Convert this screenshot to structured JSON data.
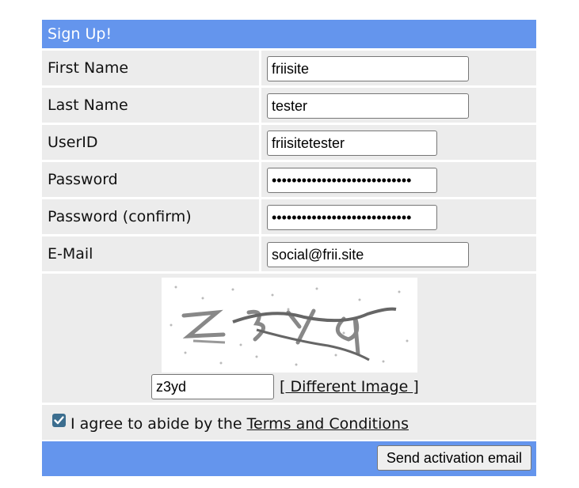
{
  "form": {
    "title": "Sign Up!",
    "fields": [
      {
        "label": "First Name",
        "value": "friisite"
      },
      {
        "label": "Last Name",
        "value": "tester"
      },
      {
        "label": "UserID",
        "value": "friisitetester"
      },
      {
        "label": "Password",
        "value": "••••••••••••••••••••••••••••"
      },
      {
        "label": "Password (confirm)",
        "value": "••••••••••••••••••••••••••••"
      },
      {
        "label": "E-Mail",
        "value": "social@frii.site"
      }
    ],
    "captcha": {
      "value": "z3yd",
      "bracket_open": "[",
      "bracket_close": "]",
      "link_label": " Different Image "
    },
    "agree": {
      "checked": true,
      "text": "I agree to abide by the ",
      "link_label": "Terms and Conditions"
    },
    "submit_label": "Send activation email"
  },
  "colors": {
    "accent": "#6495ed",
    "row_bg": "#ececec",
    "checkbox": "#3c6e8f"
  }
}
